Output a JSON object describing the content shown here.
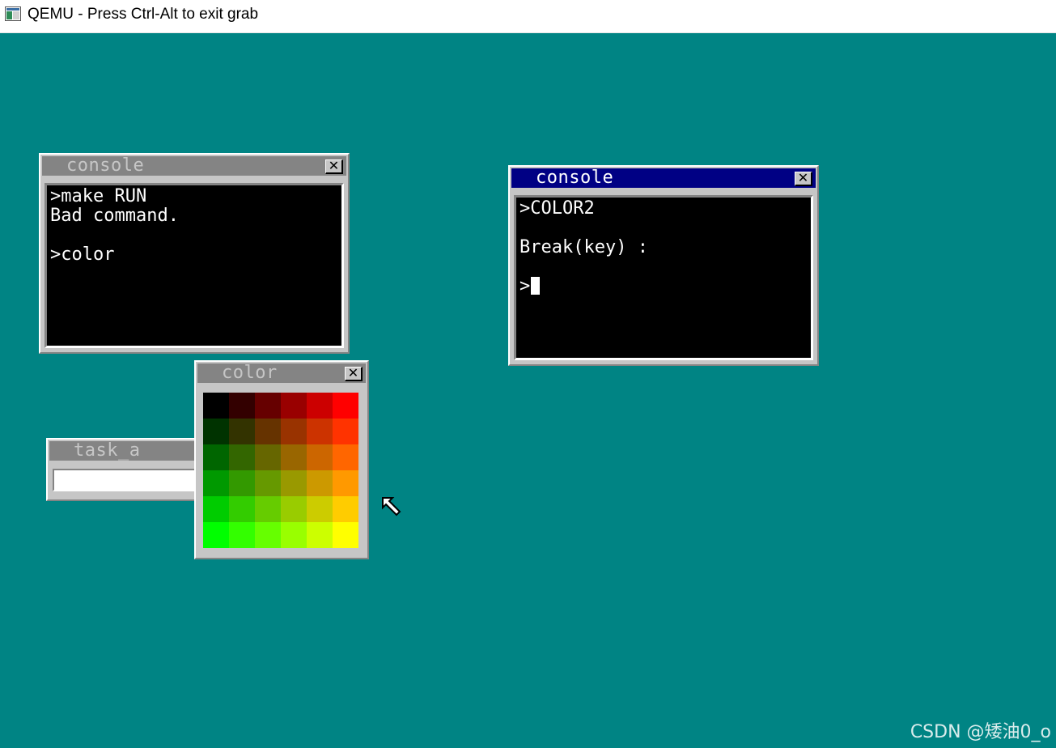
{
  "host_window": {
    "title": "QEMU - Press Ctrl-Alt to exit grab",
    "icon": "qemu-app-icon"
  },
  "desktop": {
    "background_color": "#008484"
  },
  "windows": {
    "console1": {
      "title": "console",
      "active": false,
      "close_icon": "close-icon",
      "lines": [
        ">make RUN",
        "Bad command.",
        "",
        ">color"
      ]
    },
    "console2": {
      "title": "console",
      "active": true,
      "close_icon": "close-icon",
      "lines": [
        ">COLOR2",
        "",
        "Break(key) :",
        "",
        ">"
      ]
    },
    "color": {
      "title": "color",
      "active": false,
      "close_icon": "close-icon",
      "palette_colors": [
        [
          "#000000",
          "#330000",
          "#660000",
          "#990000",
          "#cc0000",
          "#ff0000"
        ],
        [
          "#003300",
          "#333300",
          "#663300",
          "#993300",
          "#cc3300",
          "#ff3300"
        ],
        [
          "#006600",
          "#336600",
          "#666600",
          "#996600",
          "#cc6600",
          "#ff6600"
        ],
        [
          "#009900",
          "#339900",
          "#669900",
          "#999900",
          "#cc9900",
          "#ff9900"
        ],
        [
          "#00cc00",
          "#33cc00",
          "#66cc00",
          "#99cc00",
          "#cccc00",
          "#ffcc00"
        ],
        [
          "#00ff00",
          "#33ff00",
          "#66ff00",
          "#99ff00",
          "#ccff00",
          "#ffff00"
        ]
      ]
    },
    "task_a": {
      "title": "task_a",
      "active": false
    }
  },
  "mouse_cursor": "arrow-cursor-icon",
  "watermark": "CSDN @矮油0_o"
}
